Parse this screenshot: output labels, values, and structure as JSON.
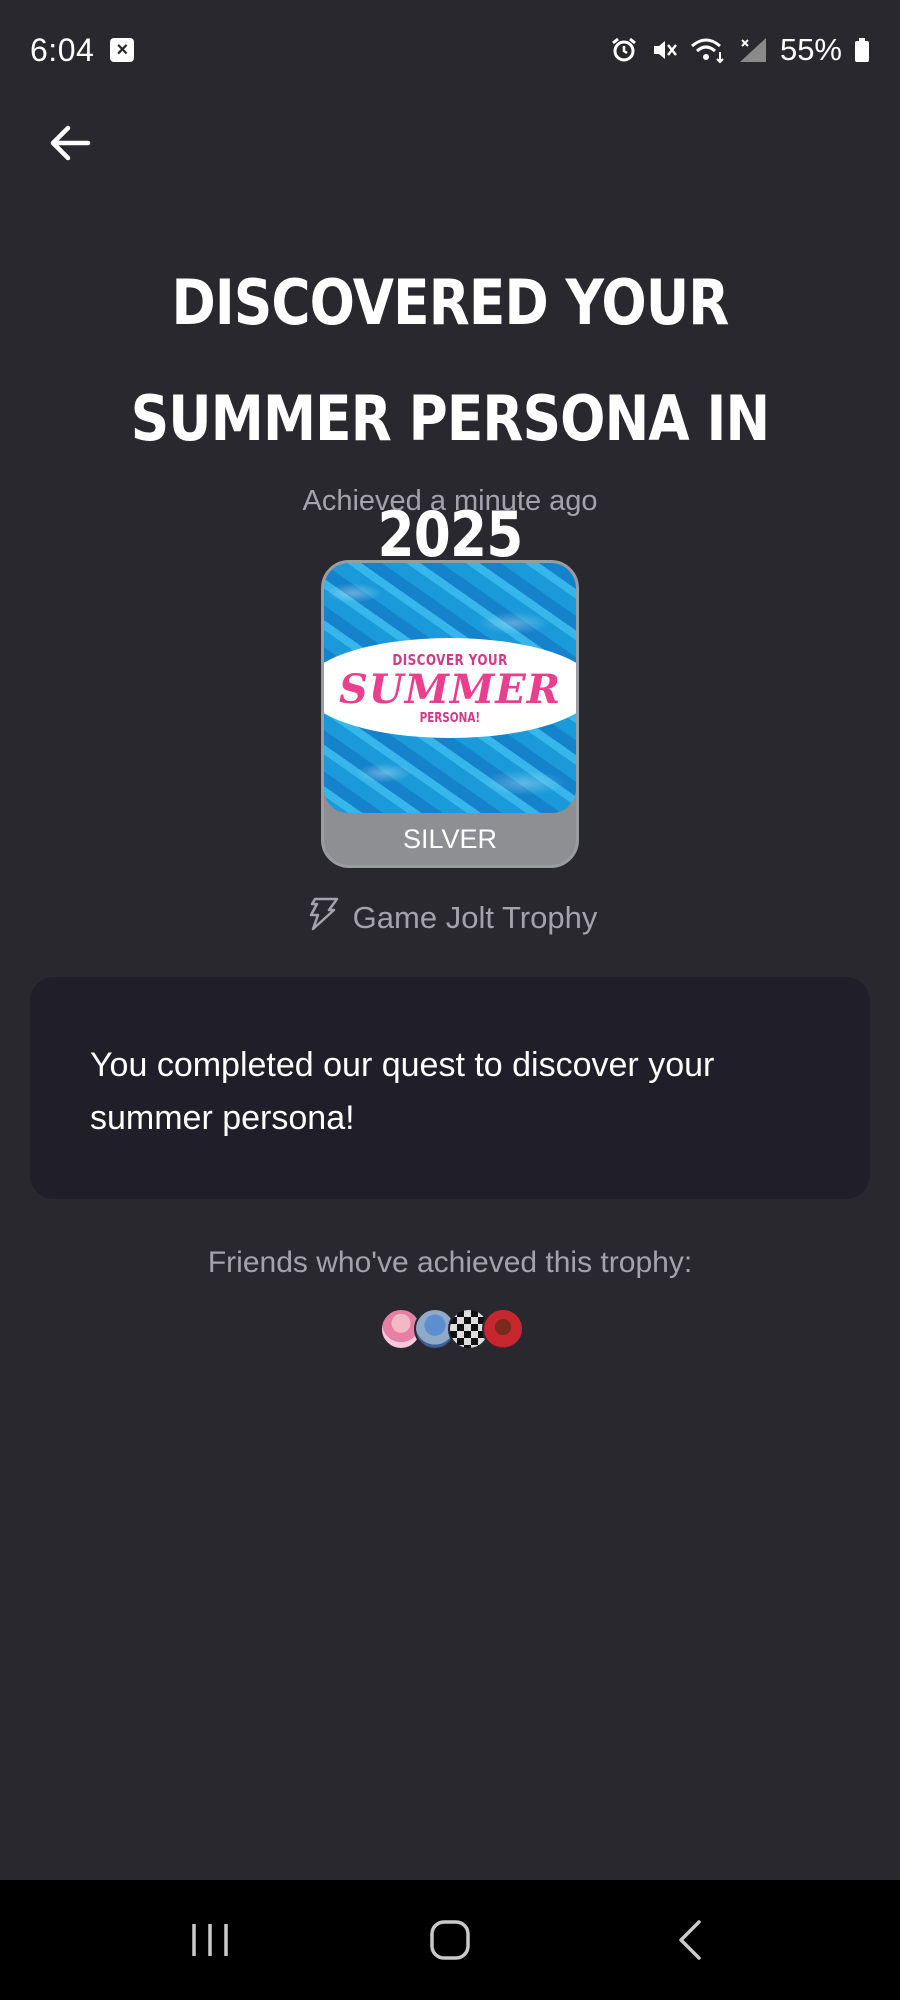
{
  "status_bar": {
    "time": "6:04",
    "battery": "55%",
    "icons": [
      "alarm-icon",
      "mute-icon",
      "wifi-icon",
      "signal-icon",
      "battery-icon"
    ]
  },
  "trophy": {
    "title": "DISCOVERED YOUR SUMMER PERSONA IN 2025",
    "achieved": "Achieved a minute ago",
    "image_text": {
      "line1": "DISCOVER YOUR",
      "line2": "SUMMER",
      "line3": "PERSONA!"
    },
    "tier": "SILVER",
    "source": "Game Jolt Trophy",
    "description": "You completed our quest to discover your summer persona!"
  },
  "friends": {
    "label": "Friends who've achieved this trophy:",
    "count": 4
  },
  "colors": {
    "background": "#29282f",
    "card": "#1f1e29",
    "muted_text": "#a4a3ab",
    "silver": "#8d8f92",
    "pink": "#ec3e8e"
  }
}
